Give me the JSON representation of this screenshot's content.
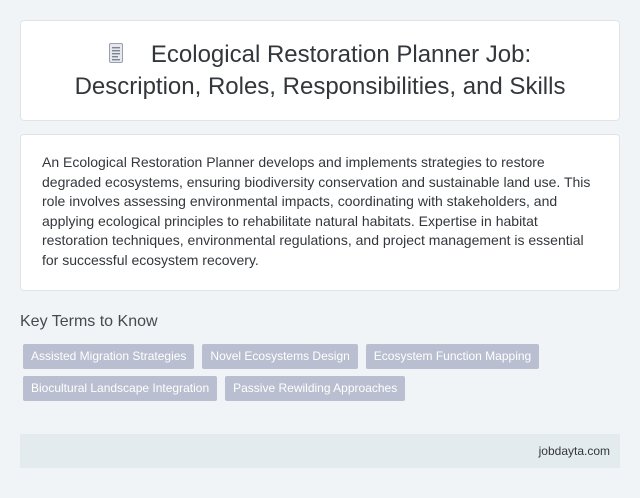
{
  "header": {
    "icon": "document-icon",
    "title_line1": "Ecological Restoration Planner Job:",
    "title_line2": "Description, Roles, Responsibilities, and Skills"
  },
  "description": "An Ecological Restoration Planner develops and implements strategies to restore degraded ecosystems, ensuring biodiversity conservation and sustainable land use. This role involves assessing environmental impacts, coordinating with stakeholders, and applying ecological principles to rehabilitate natural habitats. Expertise in habitat restoration techniques, environmental regulations, and project management is essential for successful ecosystem recovery.",
  "key_terms": {
    "heading": "Key Terms to Know",
    "tags": [
      "Assisted Migration Strategies",
      "Novel Ecosystems Design",
      "Ecosystem Function Mapping",
      "Biocultural Landscape Integration",
      "Passive Rewilding Approaches"
    ]
  },
  "footer": {
    "site": "jobdayta.com"
  },
  "colors": {
    "background": "#f1f4f7",
    "card": "#ffffff",
    "tag": "#b9bfd0",
    "footer": "#e4ebee",
    "text": "#33373b"
  }
}
